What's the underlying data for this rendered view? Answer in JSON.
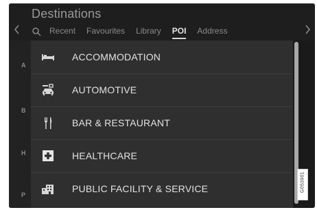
{
  "header": {
    "title": "Destinations",
    "tabs": [
      {
        "label": "Recent",
        "active": false
      },
      {
        "label": "Favourites",
        "active": false
      },
      {
        "label": "Library",
        "active": false
      },
      {
        "label": "POI",
        "active": true
      },
      {
        "label": "Address",
        "active": false
      }
    ]
  },
  "index_letters": [
    "A",
    "B",
    "H",
    "P"
  ],
  "list": {
    "items": [
      {
        "label": "ACCOMMODATION",
        "icon": "bed-icon"
      },
      {
        "label": "AUTOMOTIVE",
        "icon": "car-service-icon"
      },
      {
        "label": "BAR & RESTAURANT",
        "icon": "cutlery-icon"
      },
      {
        "label": "HEALTHCARE",
        "icon": "medical-cross-icon"
      },
      {
        "label": "PUBLIC FACILITY & SERVICE",
        "icon": "building-icon"
      }
    ]
  },
  "figure_code": "G053901",
  "colors": {
    "background": "#1a1a1a",
    "list_background": "#2f2f2f",
    "text": "#e3e3e3",
    "muted_text": "#8a8a8a"
  }
}
